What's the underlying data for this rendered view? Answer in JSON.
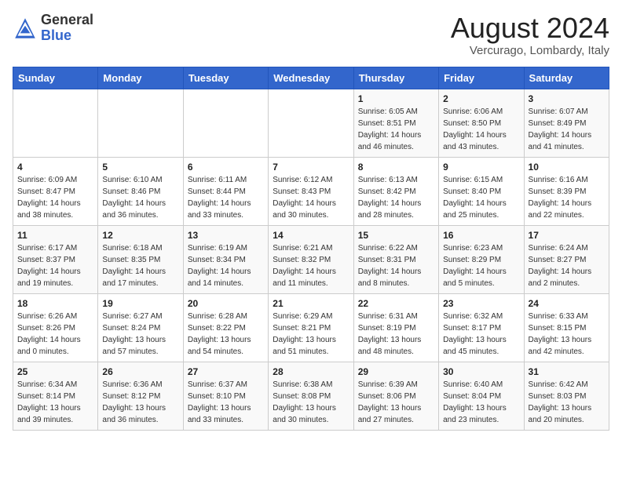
{
  "header": {
    "logo_general": "General",
    "logo_blue": "Blue",
    "month_year": "August 2024",
    "location": "Vercurago, Lombardy, Italy"
  },
  "weekdays": [
    "Sunday",
    "Monday",
    "Tuesday",
    "Wednesday",
    "Thursday",
    "Friday",
    "Saturday"
  ],
  "weeks": [
    [
      {
        "day": "",
        "info": ""
      },
      {
        "day": "",
        "info": ""
      },
      {
        "day": "",
        "info": ""
      },
      {
        "day": "",
        "info": ""
      },
      {
        "day": "1",
        "info": "Sunrise: 6:05 AM\nSunset: 8:51 PM\nDaylight: 14 hours\nand 46 minutes."
      },
      {
        "day": "2",
        "info": "Sunrise: 6:06 AM\nSunset: 8:50 PM\nDaylight: 14 hours\nand 43 minutes."
      },
      {
        "day": "3",
        "info": "Sunrise: 6:07 AM\nSunset: 8:49 PM\nDaylight: 14 hours\nand 41 minutes."
      }
    ],
    [
      {
        "day": "4",
        "info": "Sunrise: 6:09 AM\nSunset: 8:47 PM\nDaylight: 14 hours\nand 38 minutes."
      },
      {
        "day": "5",
        "info": "Sunrise: 6:10 AM\nSunset: 8:46 PM\nDaylight: 14 hours\nand 36 minutes."
      },
      {
        "day": "6",
        "info": "Sunrise: 6:11 AM\nSunset: 8:44 PM\nDaylight: 14 hours\nand 33 minutes."
      },
      {
        "day": "7",
        "info": "Sunrise: 6:12 AM\nSunset: 8:43 PM\nDaylight: 14 hours\nand 30 minutes."
      },
      {
        "day": "8",
        "info": "Sunrise: 6:13 AM\nSunset: 8:42 PM\nDaylight: 14 hours\nand 28 minutes."
      },
      {
        "day": "9",
        "info": "Sunrise: 6:15 AM\nSunset: 8:40 PM\nDaylight: 14 hours\nand 25 minutes."
      },
      {
        "day": "10",
        "info": "Sunrise: 6:16 AM\nSunset: 8:39 PM\nDaylight: 14 hours\nand 22 minutes."
      }
    ],
    [
      {
        "day": "11",
        "info": "Sunrise: 6:17 AM\nSunset: 8:37 PM\nDaylight: 14 hours\nand 19 minutes."
      },
      {
        "day": "12",
        "info": "Sunrise: 6:18 AM\nSunset: 8:35 PM\nDaylight: 14 hours\nand 17 minutes."
      },
      {
        "day": "13",
        "info": "Sunrise: 6:19 AM\nSunset: 8:34 PM\nDaylight: 14 hours\nand 14 minutes."
      },
      {
        "day": "14",
        "info": "Sunrise: 6:21 AM\nSunset: 8:32 PM\nDaylight: 14 hours\nand 11 minutes."
      },
      {
        "day": "15",
        "info": "Sunrise: 6:22 AM\nSunset: 8:31 PM\nDaylight: 14 hours\nand 8 minutes."
      },
      {
        "day": "16",
        "info": "Sunrise: 6:23 AM\nSunset: 8:29 PM\nDaylight: 14 hours\nand 5 minutes."
      },
      {
        "day": "17",
        "info": "Sunrise: 6:24 AM\nSunset: 8:27 PM\nDaylight: 14 hours\nand 2 minutes."
      }
    ],
    [
      {
        "day": "18",
        "info": "Sunrise: 6:26 AM\nSunset: 8:26 PM\nDaylight: 14 hours\nand 0 minutes."
      },
      {
        "day": "19",
        "info": "Sunrise: 6:27 AM\nSunset: 8:24 PM\nDaylight: 13 hours\nand 57 minutes."
      },
      {
        "day": "20",
        "info": "Sunrise: 6:28 AM\nSunset: 8:22 PM\nDaylight: 13 hours\nand 54 minutes."
      },
      {
        "day": "21",
        "info": "Sunrise: 6:29 AM\nSunset: 8:21 PM\nDaylight: 13 hours\nand 51 minutes."
      },
      {
        "day": "22",
        "info": "Sunrise: 6:31 AM\nSunset: 8:19 PM\nDaylight: 13 hours\nand 48 minutes."
      },
      {
        "day": "23",
        "info": "Sunrise: 6:32 AM\nSunset: 8:17 PM\nDaylight: 13 hours\nand 45 minutes."
      },
      {
        "day": "24",
        "info": "Sunrise: 6:33 AM\nSunset: 8:15 PM\nDaylight: 13 hours\nand 42 minutes."
      }
    ],
    [
      {
        "day": "25",
        "info": "Sunrise: 6:34 AM\nSunset: 8:14 PM\nDaylight: 13 hours\nand 39 minutes."
      },
      {
        "day": "26",
        "info": "Sunrise: 6:36 AM\nSunset: 8:12 PM\nDaylight: 13 hours\nand 36 minutes."
      },
      {
        "day": "27",
        "info": "Sunrise: 6:37 AM\nSunset: 8:10 PM\nDaylight: 13 hours\nand 33 minutes."
      },
      {
        "day": "28",
        "info": "Sunrise: 6:38 AM\nSunset: 8:08 PM\nDaylight: 13 hours\nand 30 minutes."
      },
      {
        "day": "29",
        "info": "Sunrise: 6:39 AM\nSunset: 8:06 PM\nDaylight: 13 hours\nand 27 minutes."
      },
      {
        "day": "30",
        "info": "Sunrise: 6:40 AM\nSunset: 8:04 PM\nDaylight: 13 hours\nand 23 minutes."
      },
      {
        "day": "31",
        "info": "Sunrise: 6:42 AM\nSunset: 8:03 PM\nDaylight: 13 hours\nand 20 minutes."
      }
    ]
  ]
}
